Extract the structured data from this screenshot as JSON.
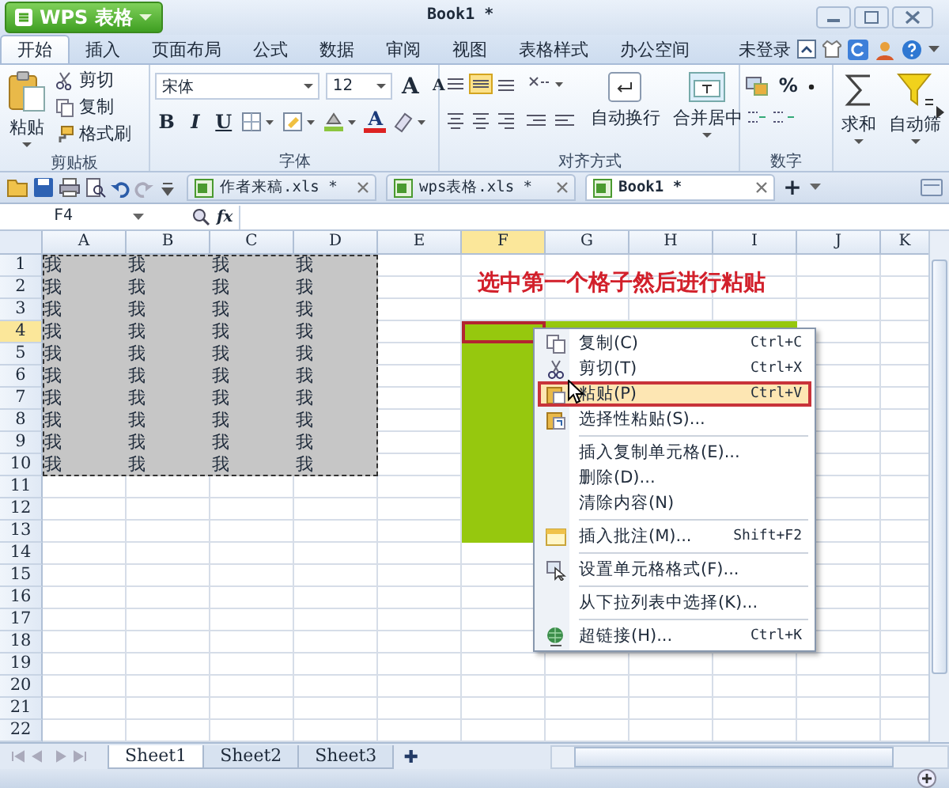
{
  "app_button": {
    "label": "WPS 表格"
  },
  "window": {
    "title": "Book1 *"
  },
  "menu_tabs": [
    {
      "label": "开始",
      "selected": true
    },
    {
      "label": "插入",
      "selected": false
    },
    {
      "label": "页面布局",
      "selected": false
    },
    {
      "label": "公式",
      "selected": false
    },
    {
      "label": "数据",
      "selected": false
    },
    {
      "label": "审阅",
      "selected": false
    },
    {
      "label": "视图",
      "selected": false
    },
    {
      "label": "表格样式",
      "selected": false
    },
    {
      "label": "办公空间",
      "selected": false
    }
  ],
  "account": "未登录",
  "ribbon": {
    "clipboard": {
      "paste": "粘贴",
      "cut": "剪切",
      "copy": "复制",
      "format_painter": "格式刷",
      "group": "剪贴板"
    },
    "font": {
      "name": "宋体",
      "size": "12",
      "grow": "A",
      "shrink": "A",
      "bold": "B",
      "italic": "I",
      "underline": "U",
      "text_color_letter": "A",
      "group": "字体"
    },
    "alignment": {
      "wrap": "自动换行",
      "merge": "合并居中",
      "group": "对齐方式"
    },
    "number": {
      "percent": "%",
      "group": "数字"
    },
    "sum": "求和",
    "filter": "自动筛"
  },
  "doc_tabs": [
    {
      "label": "作者来稿.xls *",
      "selected": false
    },
    {
      "label": "wps表格.xls *",
      "selected": false
    },
    {
      "label": "Book1 *",
      "selected": true
    }
  ],
  "new_tab": "+",
  "formula_bar": {
    "name_box": "F4",
    "fx": "fx"
  },
  "sheet": {
    "columns": [
      {
        "label": "A",
        "active": false,
        "green_zone": false
      },
      {
        "label": "B",
        "active": false,
        "green_zone": false
      },
      {
        "label": "C",
        "active": false,
        "green_zone": false
      },
      {
        "label": "D",
        "active": false,
        "green_zone": false
      },
      {
        "label": "E",
        "active": false,
        "green_zone": false
      },
      {
        "label": "F",
        "active": true,
        "green_zone": true
      },
      {
        "label": "G",
        "active": false,
        "green_zone": true
      },
      {
        "label": "H",
        "active": false,
        "green_zone": true
      },
      {
        "label": "I",
        "active": false,
        "green_zone": true
      },
      {
        "label": "J",
        "active": false,
        "green_zone": false
      },
      {
        "label": "K",
        "active": false,
        "green_zone": false
      }
    ],
    "rows": [
      {
        "label": "1",
        "cells": [
          "我",
          "我",
          "我",
          "我"
        ],
        "copied": true,
        "active": false
      },
      {
        "label": "2",
        "cells": [
          "我",
          "我",
          "我",
          "我"
        ],
        "copied": true,
        "active": false
      },
      {
        "label": "3",
        "cells": [
          "我",
          "我",
          "我",
          "我"
        ],
        "copied": true,
        "active": false
      },
      {
        "label": "4",
        "cells": [
          "我",
          "我",
          "我",
          "我"
        ],
        "copied": true,
        "active": true,
        "green": true,
        "green_across": true
      },
      {
        "label": "5",
        "cells": [
          "我",
          "我",
          "我",
          "我"
        ],
        "copied": true,
        "active": false,
        "green": true
      },
      {
        "label": "6",
        "cells": [
          "我",
          "我",
          "我",
          "我"
        ],
        "copied": true,
        "active": false,
        "green": true
      },
      {
        "label": "7",
        "cells": [
          "我",
          "我",
          "我",
          "我"
        ],
        "copied": true,
        "active": false,
        "green": true
      },
      {
        "label": "8",
        "cells": [
          "我",
          "我",
          "我",
          "我"
        ],
        "copied": true,
        "active": false,
        "green": true
      },
      {
        "label": "9",
        "cells": [
          "我",
          "我",
          "我",
          "我"
        ],
        "copied": true,
        "active": false,
        "green": true
      },
      {
        "label": "10",
        "cells": [
          "我",
          "我",
          "我",
          "我"
        ],
        "copied": true,
        "active": false,
        "green": true
      },
      {
        "label": "11",
        "active": false,
        "green": true
      },
      {
        "label": "12",
        "active": false,
        "green": true
      },
      {
        "label": "13",
        "active": false,
        "green": true
      },
      {
        "label": "14",
        "active": false
      },
      {
        "label": "15",
        "active": false
      },
      {
        "label": "16",
        "active": false
      },
      {
        "label": "17",
        "active": false
      },
      {
        "label": "18",
        "active": false
      },
      {
        "label": "19",
        "active": false
      },
      {
        "label": "20",
        "active": false
      },
      {
        "label": "21",
        "active": false
      },
      {
        "label": "22",
        "active": false
      }
    ],
    "annotation": "选中第一个格子然后进行粘贴"
  },
  "context_menu": [
    {
      "kind": "copy",
      "label": "复制(C)",
      "shortcut": "Ctrl+C",
      "selected": false
    },
    {
      "kind": "cut",
      "label": "剪切(T)",
      "shortcut": "Ctrl+X",
      "selected": false
    },
    {
      "kind": "paste",
      "label": "粘贴(P)",
      "shortcut": "Ctrl+V",
      "selected": true
    },
    {
      "kind": "special",
      "label": "选择性粘贴(S)...",
      "selected": false
    },
    {
      "kind": "separator"
    },
    {
      "kind": "plain",
      "label": "插入复制单元格(E)...",
      "selected": false
    },
    {
      "kind": "plain",
      "label": "删除(D)...",
      "selected": false
    },
    {
      "kind": "plain",
      "label": "清除内容(N)",
      "selected": false
    },
    {
      "kind": "separator"
    },
    {
      "kind": "comment",
      "label": "插入批注(M)...",
      "shortcut": "Shift+F2",
      "selected": false
    },
    {
      "kind": "separator"
    },
    {
      "kind": "format",
      "label": "设置单元格格式(F)...",
      "selected": false
    },
    {
      "kind": "separator"
    },
    {
      "kind": "plain",
      "label": "从下拉列表中选择(K)...",
      "selected": false
    },
    {
      "kind": "separator"
    },
    {
      "kind": "link",
      "label": "超链接(H)...",
      "shortcut": "Ctrl+K",
      "selected": false
    }
  ],
  "sheet_tabs": [
    {
      "label": "Sheet1",
      "selected": true
    },
    {
      "label": "Sheet2",
      "selected": false
    },
    {
      "label": "Sheet3",
      "selected": false
    }
  ],
  "add_sheet": "✚"
}
